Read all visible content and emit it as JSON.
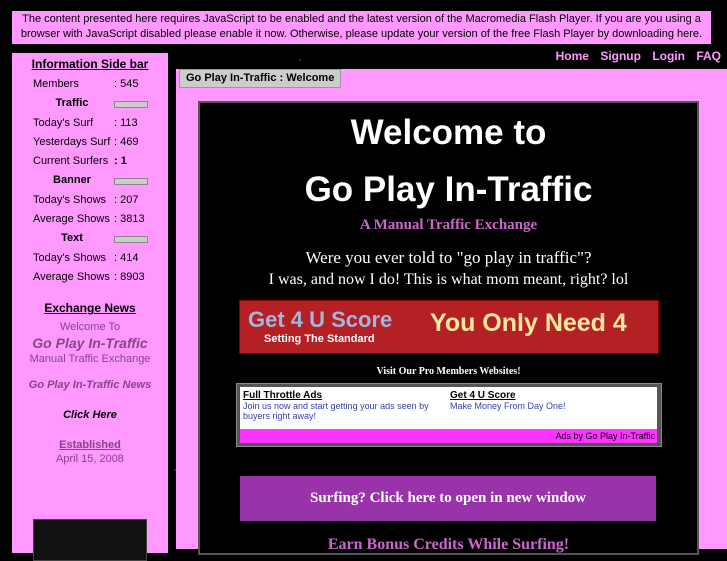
{
  "notice": "The content presented here requires JavaScript to be enabled and the latest version of the Macromedia Flash Player. If you are you using a browser with JavaScript disabled please enable it now. Otherwise, please update your version of the free Flash Player by downloading here.",
  "nav": [
    "Home",
    "Signup",
    "Login",
    "FAQ"
  ],
  "sidebar": {
    "title": "Information Side bar",
    "members_label": "Members",
    "members_value": ": 545",
    "traffic_header": "Traffic",
    "today_surf_label": "Today's Surf",
    "today_surf_value": ": 113",
    "yesterday_surf_label": "Yesterdays Surf",
    "yesterday_surf_value": ": 469",
    "current_surfers_label": "Current Surfers",
    "current_surfers_value": ": 1",
    "banner_header": "Banner",
    "banner_today_label": "Today's Shows",
    "banner_today_value": ": 207",
    "banner_avg_label": "Average Shows",
    "banner_avg_value": ": 3813",
    "text_header": "Text",
    "text_today_label": "Today's Shows",
    "text_today_value": ": 414",
    "text_avg_label": "Average Shows",
    "text_avg_value": ": 8903",
    "news_title": "Exchange News",
    "welcome_to": "Welcome To",
    "brand": "Go Play In-Traffic",
    "mte": "Manual Traffic Exchange",
    "news": "Go Play In-Traffic News",
    "click_here": "Click Here",
    "established": "Established",
    "established_date": "April 15, 2008"
  },
  "main": {
    "tab": "Go Play In-Traffic : Welcome",
    "welcome_line1": "Welcome to",
    "welcome_line2": "Go Play In-Traffic",
    "tagline": "A Manual Traffic Exchange",
    "question": "Were you ever told to \"go play in traffic\"?",
    "answer": "I was, and now I do! This is what mom meant, right? lol",
    "score_title": "Get 4 U Score",
    "score_sub": "Setting The Standard",
    "score_need": "You Only Need 4",
    "visit": "Visit Our Pro Members Websites!",
    "ad1_title": "Full Throttle Ads",
    "ad1_desc": "Join us now and start getting your ads seen by buyers right away!",
    "ad2_title": "Get 4 U Score",
    "ad2_desc": "Make Money From Day One!",
    "ads_by": "Ads by Go Play In-Traffic",
    "surf_button": "Surfing? Click here to open in new window",
    "earn": "Earn Bonus Credits While Surfing!"
  }
}
